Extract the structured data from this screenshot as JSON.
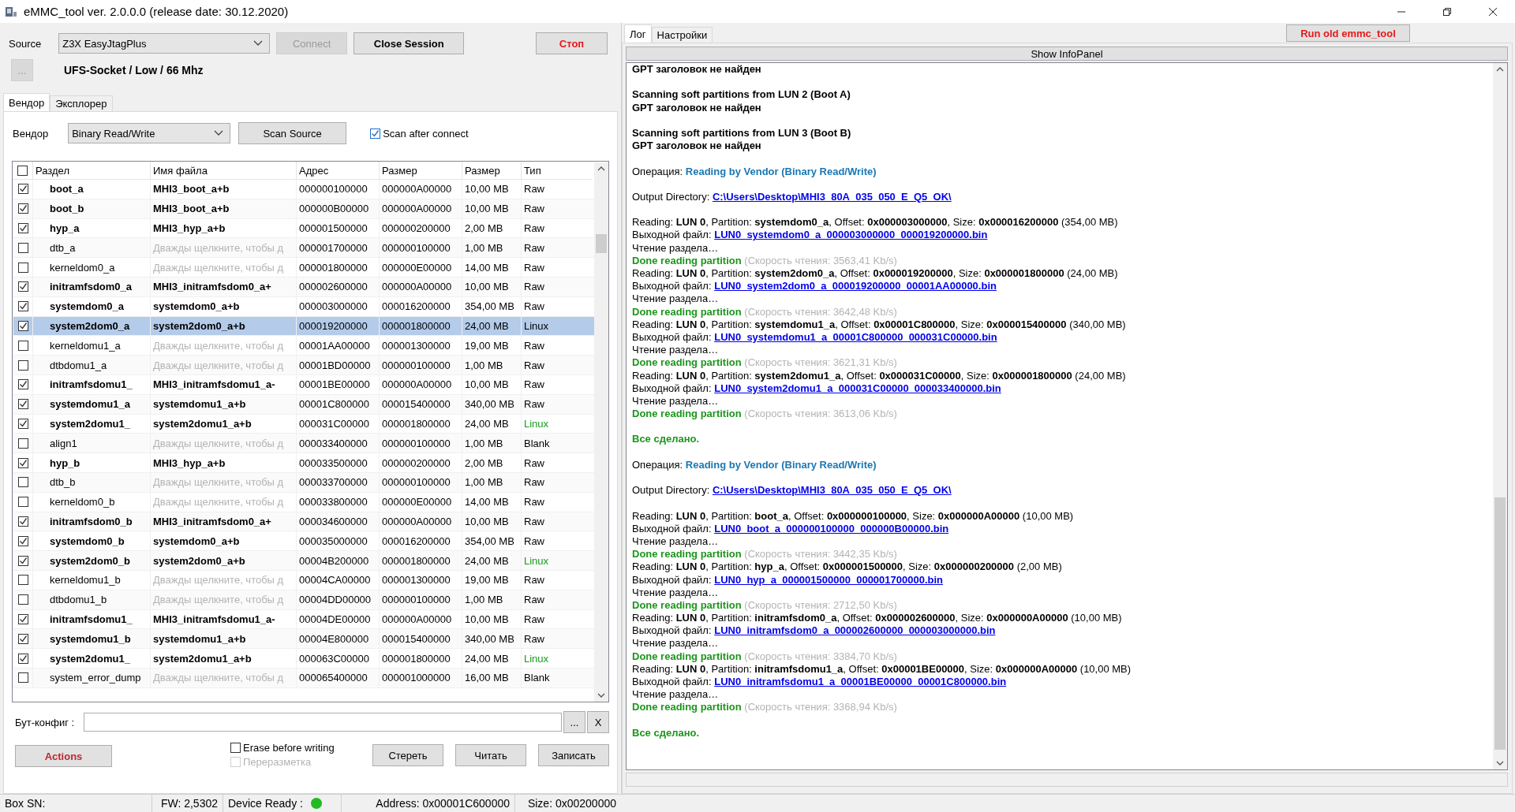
{
  "window": {
    "title": "eMMC_tool ver. 2.0.0.0 (release date: 30.12.2020)"
  },
  "source": {
    "label": "Source",
    "value": "Z3X EasyJtagPlus",
    "connect": {
      "label": "Connect",
      "disabled": true
    },
    "close_session": "Close Session",
    "stop": "Стоп",
    "more": "...",
    "info": "UFS-Socket / Low / 66 Mhz"
  },
  "left_tabs": [
    {
      "label": "Вендор",
      "selected": true
    },
    {
      "label": "Эксплорер",
      "selected": false
    }
  ],
  "vendor": {
    "label": "Вендор",
    "value": "Binary Read/Write",
    "scan": "Scan Source",
    "scan_after_connect": {
      "label": "Scan after connect",
      "checked": true
    }
  },
  "table": {
    "all_checked": false,
    "columns": [
      "Раздел",
      "Имя файла",
      "Адрес",
      "Размер",
      "Размер",
      "Тип"
    ],
    "rows": [
      {
        "checked": true,
        "selected": false,
        "name": "boot_a",
        "file": "MHI3_boot_a+b",
        "address": "000000100000",
        "size": "000000A00000",
        "size_mb": "10,00 MB",
        "type": "Raw",
        "color": "#000000"
      },
      {
        "checked": true,
        "selected": false,
        "name": "boot_b",
        "file": "MHI3_boot_a+b",
        "address": "000000B00000",
        "size": "000000A00000",
        "size_mb": "10,00 MB",
        "type": "Raw",
        "color": "#000000"
      },
      {
        "checked": true,
        "selected": false,
        "name": "hyp_a",
        "file": "MHI3_hyp_a+b",
        "address": "000001500000",
        "size": "000000200000",
        "size_mb": "2,00 MB",
        "type": "Raw",
        "color": "#000000"
      },
      {
        "checked": false,
        "selected": false,
        "name": "dtb_a",
        "file_hint": "Дважды щелкните, чтобы д",
        "address": "000001700000",
        "size": "000000100000",
        "size_mb": "1,00 MB",
        "type": "Raw",
        "color": "#000000"
      },
      {
        "checked": false,
        "selected": false,
        "name": "kerneldom0_a",
        "file_hint": "Дважды щелкните, чтобы д",
        "address": "000001800000",
        "size": "000000E00000",
        "size_mb": "14,00 MB",
        "type": "Raw",
        "color": "#000000"
      },
      {
        "checked": true,
        "selected": false,
        "name": "initramfsdom0_a",
        "file": "MHI3_initramfsdom0_a+",
        "address": "000002600000",
        "size": "000000A00000",
        "size_mb": "10,00 MB",
        "type": "Raw",
        "color": "#000000"
      },
      {
        "checked": true,
        "selected": false,
        "name": "systemdom0_a",
        "file": "systemdom0_a+b",
        "address": "000003000000",
        "size": "000016200000",
        "size_mb": "354,00 MB",
        "type": "Raw",
        "color": "#000000"
      },
      {
        "checked": true,
        "selected": true,
        "name": "system2dom0_a",
        "file": "system2dom0_a+b",
        "address": "000019200000",
        "size": "000001800000",
        "size_mb": "24,00 MB",
        "type": "Linux",
        "color": "#000000"
      },
      {
        "checked": false,
        "selected": false,
        "name": "kerneldomu1_a",
        "file_hint": "Дважды щелкните, чтобы д",
        "address": "00001AA00000",
        "size": "000001300000",
        "size_mb": "19,00 MB",
        "type": "Raw",
        "color": "#000000"
      },
      {
        "checked": false,
        "selected": false,
        "name": "dtbdomu1_a",
        "file_hint": "Дважды щелкните, чтобы д",
        "address": "00001BD00000",
        "size": "000000100000",
        "size_mb": "1,00 MB",
        "type": "Raw",
        "color": "#000000"
      },
      {
        "checked": true,
        "selected": false,
        "name": "initramfsdomu1_",
        "file": "MHI3_initramfsdomu1_a-",
        "address": "00001BE00000",
        "size": "000000A00000",
        "size_mb": "10,00 MB",
        "type": "Raw",
        "color": "#000000"
      },
      {
        "checked": true,
        "selected": false,
        "name": "systemdomu1_a",
        "file": "systemdomu1_a+b",
        "address": "00001C800000",
        "size": "000015400000",
        "size_mb": "340,00 MB",
        "type": "Raw",
        "color": "#000000"
      },
      {
        "checked": true,
        "selected": false,
        "name": "system2domu1_",
        "file": "system2domu1_a+b",
        "address": "000031C00000",
        "size": "000001800000",
        "size_mb": "24,00 MB",
        "type": "Linux",
        "color": "#1a9a1a"
      },
      {
        "checked": false,
        "selected": false,
        "name": "align1",
        "file_hint": "Дважды щелкните, чтобы д",
        "address": "000033400000",
        "size": "000000100000",
        "size_mb": "1,00 MB",
        "type": "Blank",
        "color": "#000000"
      },
      {
        "checked": true,
        "selected": false,
        "name": "hyp_b",
        "file": "MHI3_hyp_a+b",
        "address": "000033500000",
        "size": "000000200000",
        "size_mb": "2,00 MB",
        "type": "Raw",
        "color": "#000000"
      },
      {
        "checked": false,
        "selected": false,
        "name": "dtb_b",
        "file_hint": "Дважды щелкните, чтобы д",
        "address": "000033700000",
        "size": "000000100000",
        "size_mb": "1,00 MB",
        "type": "Raw",
        "color": "#000000"
      },
      {
        "checked": false,
        "selected": false,
        "name": "kerneldom0_b",
        "file_hint": "Дважды щелкните, чтобы д",
        "address": "000033800000",
        "size": "000000E00000",
        "size_mb": "14,00 MB",
        "type": "Raw",
        "color": "#000000"
      },
      {
        "checked": true,
        "selected": false,
        "name": "initramfsdom0_b",
        "file": "MHI3_initramfsdom0_a+",
        "address": "000034600000",
        "size": "000000A00000",
        "size_mb": "10,00 MB",
        "type": "Raw",
        "color": "#000000"
      },
      {
        "checked": true,
        "selected": false,
        "name": "systemdom0_b",
        "file": "systemdom0_a+b",
        "address": "000035000000",
        "size": "000016200000",
        "size_mb": "354,00 MB",
        "type": "Raw",
        "color": "#000000"
      },
      {
        "checked": true,
        "selected": false,
        "name": "system2dom0_b",
        "file": "system2dom0_a+b",
        "address": "00004B200000",
        "size": "000001800000",
        "size_mb": "24,00 MB",
        "type": "Linux",
        "color": "#1a9a1a"
      },
      {
        "checked": false,
        "selected": false,
        "name": "kerneldomu1_b",
        "file_hint": "Дважды щелкните, чтобы д",
        "address": "00004CA00000",
        "size": "000001300000",
        "size_mb": "19,00 MB",
        "type": "Raw",
        "color": "#000000"
      },
      {
        "checked": false,
        "selected": false,
        "name": "dtbdomu1_b",
        "file_hint": "Дважды щелкните, чтобы д",
        "address": "00004DD00000",
        "size": "000000100000",
        "size_mb": "1,00 MB",
        "type": "Raw",
        "color": "#000000"
      },
      {
        "checked": true,
        "selected": false,
        "name": "initramfsdomu1_",
        "file": "MHI3_initramfsdomu1_a-",
        "address": "00004DE00000",
        "size": "000000A00000",
        "size_mb": "10,00 MB",
        "type": "Raw",
        "color": "#000000"
      },
      {
        "checked": true,
        "selected": false,
        "name": "systemdomu1_b",
        "file": "systemdomu1_a+b",
        "address": "00004E800000",
        "size": "000015400000",
        "size_mb": "340,00 MB",
        "type": "Raw",
        "color": "#000000"
      },
      {
        "checked": true,
        "selected": false,
        "name": "system2domu1_",
        "file": "system2domu1_a+b",
        "address": "000063C00000",
        "size": "000001800000",
        "size_mb": "24,00 MB",
        "type": "Linux",
        "color": "#1a9a1a"
      },
      {
        "checked": false,
        "selected": false,
        "name": "system_error_dump",
        "file_hint": "Дважды щелкните, чтобы д",
        "address": "000065400000",
        "size": "000001000000",
        "size_mb": "16,00 MB",
        "type": "Blank",
        "color": "#000000"
      }
    ]
  },
  "boot_config": {
    "label": "Бут-конфиг  :",
    "browse": "...",
    "clear": "X"
  },
  "actions": "Actions",
  "erase_before_writing": {
    "label": "Erase before writing",
    "checked": false
  },
  "repartition": {
    "label": "Переразметка",
    "checked": false,
    "disabled": true
  },
  "buttons": [
    "Стереть",
    "Читать",
    "Записать"
  ],
  "right_tabs": [
    {
      "label": "Лог",
      "selected": true
    },
    {
      "label": "Настройки",
      "selected": false
    }
  ],
  "run_old": "Run old emmc_tool",
  "show_infopanel": "Show InfoPanel",
  "log": [
    {
      "kind": "bold",
      "text": "GPT заголовок не найден"
    },
    {
      "kind": "spacer"
    },
    {
      "kind": "bold",
      "text": "Scanning soft partitions from LUN 2 (Boot A)"
    },
    {
      "kind": "bold",
      "text": "GPT заголовок не найден"
    },
    {
      "kind": "spacer"
    },
    {
      "kind": "bold",
      "text": "Scanning soft partitions from LUN 3 (Boot B)"
    },
    {
      "kind": "bold",
      "text": "GPT заголовок не найден"
    },
    {
      "kind": "spacer"
    },
    {
      "kind": "operation",
      "label": "Операция:",
      "value": "Reading by Vendor (Binary Read/Write)"
    },
    {
      "kind": "spacer"
    },
    {
      "kind": "link",
      "label": "Output Directory:",
      "link": "C:\\Users\\Desktop\\MHI3_80A_035_050_E_Q5_OK\\"
    },
    {
      "kind": "spacer"
    },
    {
      "kind": "reading",
      "text": "Reading: **LUN 0**, Partition: **systemdom0_a**, Offset: **0x000003000000**, Size: **0x000016200000** (354,00 MB)"
    },
    {
      "kind": "link",
      "label": "Выходной файл:",
      "link": "LUN0_systemdom0_a_000003000000_000019200000.bin"
    },
    {
      "kind": "plain",
      "text": "Чтение раздела…"
    },
    {
      "kind": "done",
      "text": "Done reading partition",
      "speed": "(Скорость чтения: 3563,41 Kb/s)"
    },
    {
      "kind": "reading",
      "text": "Reading: **LUN 0**, Partition: **system2dom0_a**, Offset: **0x000019200000**, Size: **0x000001800000** (24,00 MB)"
    },
    {
      "kind": "link",
      "label": "Выходной файл:",
      "link": "LUN0_system2dom0_a_000019200000_00001AA00000.bin"
    },
    {
      "kind": "plain",
      "text": "Чтение раздела…"
    },
    {
      "kind": "done",
      "text": "Done reading partition",
      "speed": "(Скорость чтения: 3642,48 Kb/s)"
    },
    {
      "kind": "reading",
      "text": "Reading: **LUN 0**, Partition: **systemdomu1_a**, Offset: **0x00001C800000**, Size: **0x000015400000** (340,00 MB)"
    },
    {
      "kind": "link",
      "label": "Выходной файл:",
      "link": "LUN0_systemdomu1_a_00001C800000_000031C00000.bin"
    },
    {
      "kind": "plain",
      "text": "Чтение раздела…"
    },
    {
      "kind": "done",
      "text": "Done reading partition",
      "speed": "(Скорость чтения: 3621,31 Kb/s)"
    },
    {
      "kind": "reading",
      "text": "Reading: **LUN 0**, Partition: **system2domu1_a**, Offset: **0x000031C00000**, Size: **0x000001800000** (24,00 MB)"
    },
    {
      "kind": "link",
      "label": "Выходной файл:",
      "link": "LUN0_system2domu1_a_000031C00000_000033400000.bin"
    },
    {
      "kind": "plain",
      "text": "Чтение раздела…"
    },
    {
      "kind": "done",
      "text": "Done reading partition",
      "speed": "(Скорость чтения: 3613,06 Kb/s)"
    },
    {
      "kind": "spacer"
    },
    {
      "kind": "finished",
      "text": "Все сделано."
    },
    {
      "kind": "spacer"
    },
    {
      "kind": "operation",
      "label": "Операция:",
      "value": "Reading by Vendor (Binary Read/Write)"
    },
    {
      "kind": "spacer"
    },
    {
      "kind": "link",
      "label": "Output Directory:",
      "link": "C:\\Users\\Desktop\\MHI3_80A_035_050_E_Q5_OK\\"
    },
    {
      "kind": "spacer"
    },
    {
      "kind": "reading",
      "text": "Reading: **LUN 0**, Partition: **boot_a**, Offset: **0x000000100000**, Size: **0x000000A00000** (10,00 MB)"
    },
    {
      "kind": "link",
      "label": "Выходной файл:",
      "link": "LUN0_boot_a_000000100000_000000B00000.bin"
    },
    {
      "kind": "plain",
      "text": "Чтение раздела…"
    },
    {
      "kind": "done",
      "text": "Done reading partition",
      "speed": "(Скорость чтения: 3442,35 Kb/s)"
    },
    {
      "kind": "reading",
      "text": "Reading: **LUN 0**, Partition: **hyp_a**, Offset: **0x000001500000**, Size: **0x000000200000** (2,00 MB)"
    },
    {
      "kind": "link",
      "label": "Выходной файл:",
      "link": "LUN0_hyp_a_000001500000_000001700000.bin"
    },
    {
      "kind": "plain",
      "text": "Чтение раздела…"
    },
    {
      "kind": "done",
      "text": "Done reading partition",
      "speed": "(Скорость чтения: 2712,50 Kb/s)"
    },
    {
      "kind": "reading",
      "text": "Reading: **LUN 0**, Partition: **initramfsdom0_a**, Offset: **0x000002600000**, Size: **0x000000A00000** (10,00 MB)"
    },
    {
      "kind": "link",
      "label": "Выходной файл:",
      "link": "LUN0_initramfsdom0_a_000002600000_000003000000.bin"
    },
    {
      "kind": "plain",
      "text": "Чтение раздела…"
    },
    {
      "kind": "done",
      "text": "Done reading partition",
      "speed": "(Скорость чтения: 3384,70 Kb/s)"
    },
    {
      "kind": "reading",
      "text": "Reading: **LUN 0**, Partition: **initramfsdomu1_a**, Offset: **0x00001BE00000**, Size: **0x000000A00000** (10,00 MB)"
    },
    {
      "kind": "link",
      "label": "Выходной файл:",
      "link": "LUN0_initramfsdomu1_a_00001BE00000_00001C800000.bin"
    },
    {
      "kind": "plain",
      "text": "Чтение раздела…"
    },
    {
      "kind": "done",
      "text": "Done reading partition",
      "speed": "(Скорость чтения: 3368,94 Kb/s)"
    },
    {
      "kind": "spacer"
    },
    {
      "kind": "finished",
      "text": "Все сделано."
    }
  ],
  "status_bar": {
    "box_sn": "Box SN:",
    "fw": "FW:  2,5302",
    "device_ready": {
      "label": "Device Ready :",
      "on": true
    },
    "address": "Address: 0x00001C600000",
    "size": "Size: 0x00200000"
  }
}
